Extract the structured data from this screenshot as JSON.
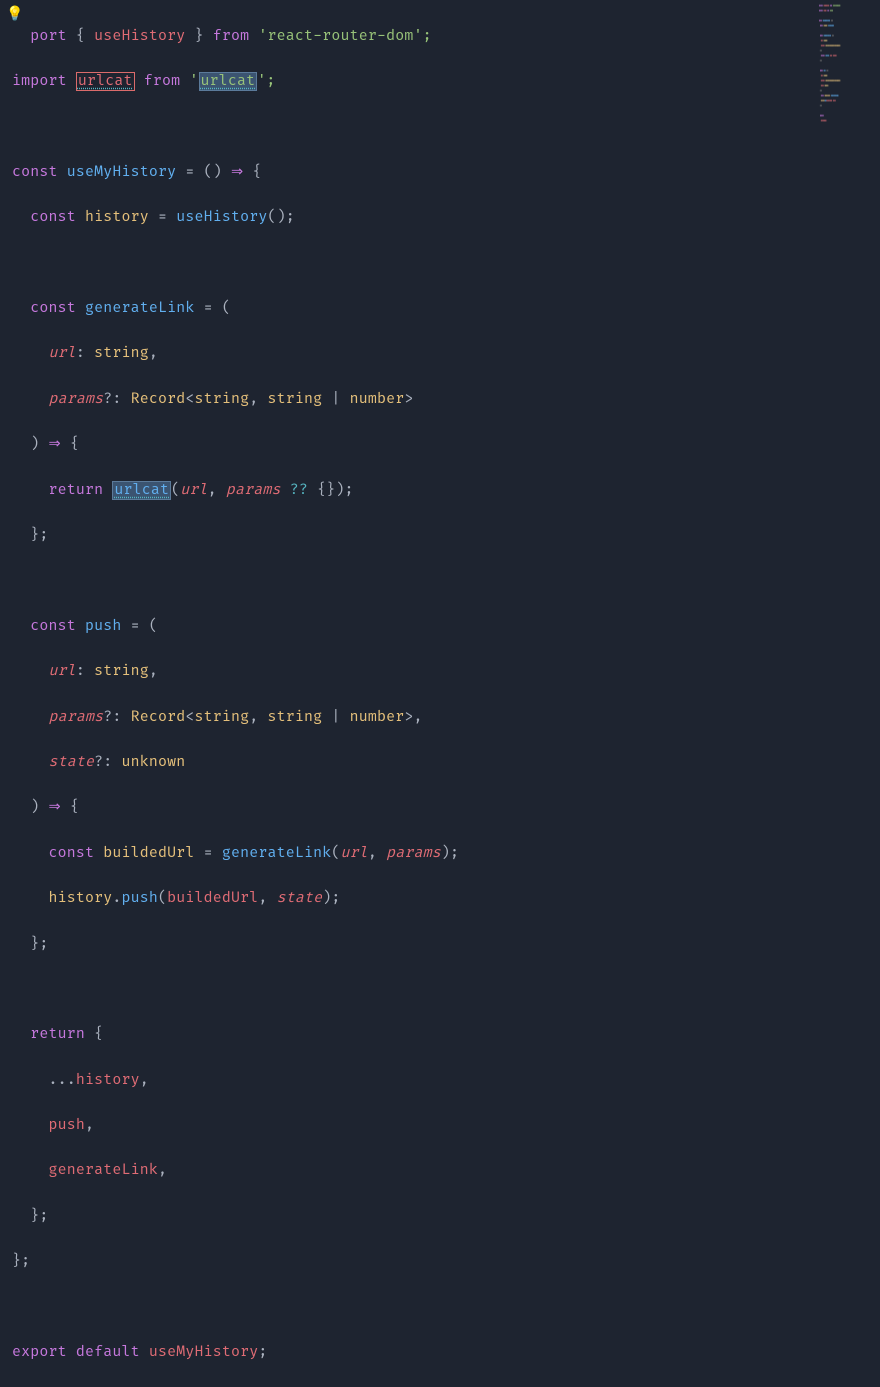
{
  "bulb_icon": "💡",
  "code_lines": {
    "l1": {
      "a": "  port",
      "b": " { ",
      "c": "useHistory",
      "d": " } ",
      "e": "from",
      "f": " '",
      "g": "react-router-dom",
      "h": "';"
    },
    "l2": {
      "a": "import",
      "b": " ",
      "c": "urlcat",
      "d": " ",
      "e": "from",
      "f": " '",
      "g": "urlcat",
      "h": "';"
    },
    "l3": "",
    "l4": {
      "a": "const",
      "b": " ",
      "c": "useMyHistory",
      "d": " = () ",
      "e": "⇒",
      "f": " {"
    },
    "l5": {
      "a": "  const",
      "b": " ",
      "c": "history",
      "d": " = ",
      "e": "useHistory",
      "f": "();"
    },
    "l6": "",
    "l7": {
      "a": "  const",
      "b": " ",
      "c": "generateLink",
      "d": " = ("
    },
    "l8": {
      "a": "    ",
      "b": "url",
      "c": ": ",
      "d": "string",
      "e": ","
    },
    "l9": {
      "a": "    ",
      "b": "params",
      "c": "?: ",
      "d": "Record",
      "e": "<",
      "f": "string",
      "g": ", ",
      "h": "string",
      "i": " | ",
      "j": "number",
      "k": ">"
    },
    "l10": {
      "a": "  ) ",
      "b": "⇒",
      "c": " {"
    },
    "l11": {
      "a": "    return",
      "b": " ",
      "c": "urlcat",
      "d": "(",
      "e": "url",
      "f": ", ",
      "g": "params",
      "h": " ",
      "i": "??",
      "j": " {});"
    },
    "l12": {
      "a": "  };"
    },
    "l13": "",
    "l14": {
      "a": "  const",
      "b": " ",
      "c": "push",
      "d": " = ("
    },
    "l15": {
      "a": "    ",
      "b": "url",
      "c": ": ",
      "d": "string",
      "e": ","
    },
    "l16": {
      "a": "    ",
      "b": "params",
      "c": "?: ",
      "d": "Record",
      "e": "<",
      "f": "string",
      "g": ", ",
      "h": "string",
      "i": " | ",
      "j": "number",
      "k": ">,"
    },
    "l17": {
      "a": "    ",
      "b": "state",
      "c": "?: ",
      "d": "unknown"
    },
    "l18": {
      "a": "  ) ",
      "b": "⇒",
      "c": " {"
    },
    "l19": {
      "a": "    const",
      "b": " ",
      "c": "buildedUrl",
      "d": " = ",
      "e": "generateLink",
      "f": "(",
      "g": "url",
      "h": ", ",
      "i": "params",
      "j": ");"
    },
    "l20": {
      "a": "    ",
      "b": "history",
      "c": ".",
      "d": "push",
      "e": "(",
      "f": "buildedUrl",
      "g": ", ",
      "h": "state",
      "i": ");"
    },
    "l21": {
      "a": "  };"
    },
    "l22": "",
    "l23": {
      "a": "  return",
      "b": " {"
    },
    "l24": {
      "a": "    ...",
      "b": "history",
      "c": ","
    },
    "l25": {
      "a": "    ",
      "b": "push",
      "c": ","
    },
    "l26": {
      "a": "    ",
      "b": "generateLink",
      "c": ","
    },
    "l27": {
      "a": "  };"
    },
    "l28": {
      "a": "};"
    },
    "l29": "",
    "l30": {
      "a": "export",
      "b": " ",
      "c": "default",
      "d": " ",
      "e": "useMyHistory",
      "f": ";"
    }
  }
}
